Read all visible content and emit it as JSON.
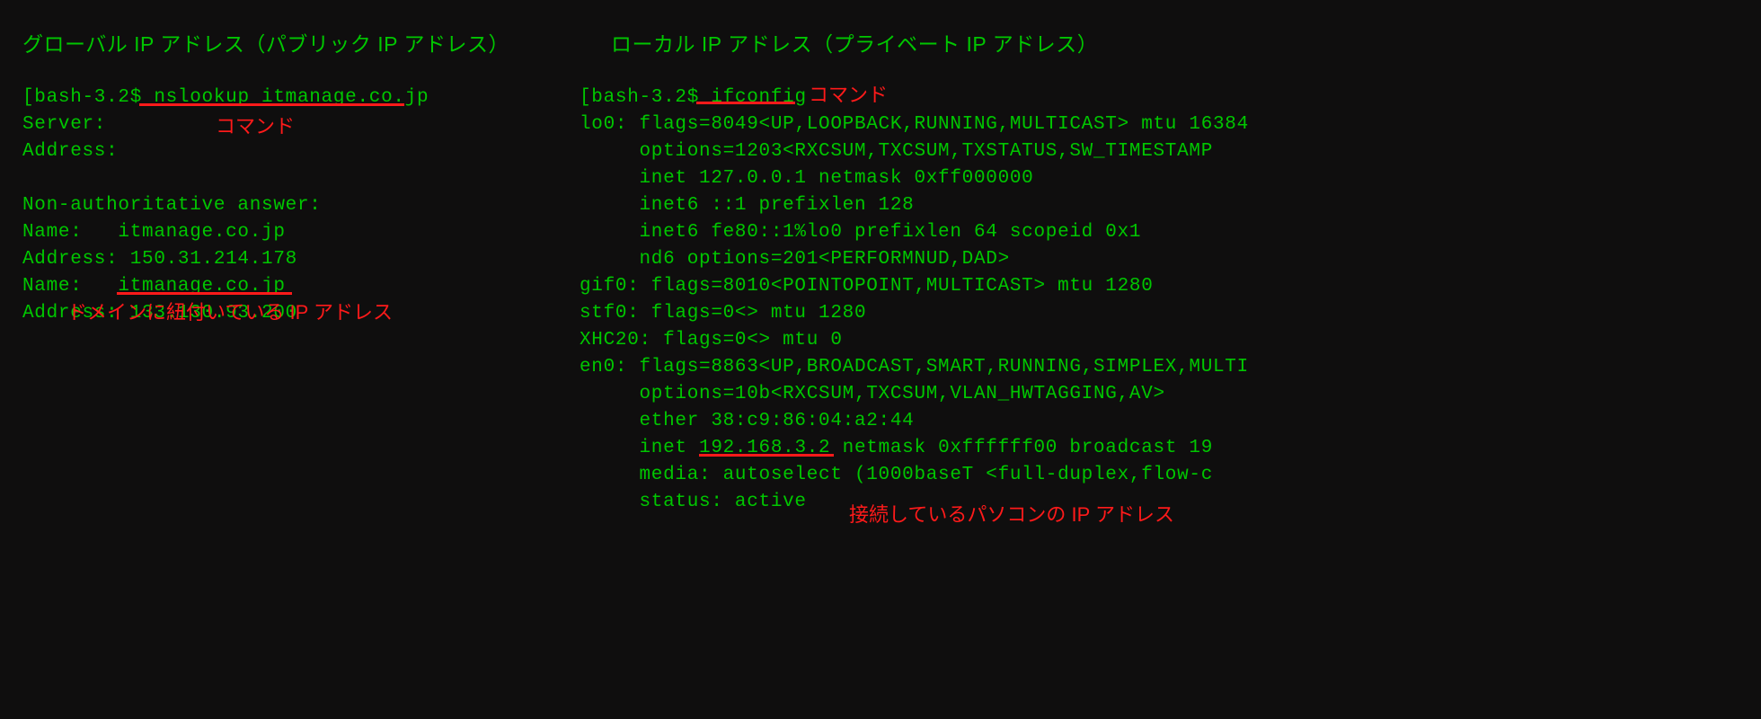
{
  "left": {
    "title": "グローバル IP アドレス（パブリック IP アドレス）",
    "prompt": "[bash-3.2$ ",
    "command": "nslookup itmanage.co.jp",
    "output": "Server:\nAddress:\n\nNon-authoritative answer:\nName:   itmanage.co.jp\nAddress: 150.31.214.178\nName:   itmanage.co.jp\nAddress: ",
    "highlight_ip": "133.130.93.200",
    "annot_command": "コマンド",
    "annot_ip": "ドメインに紐付いている IP アドレス"
  },
  "right": {
    "title": "ローカル IP アドレス（プライベート IP アドレス）",
    "prompt": "[bash-3.2$ ",
    "command": "ifconfig",
    "output_part1": "lo0: flags=8049<UP,LOOPBACK,RUNNING,MULTICAST> mtu 16384\n     options=1203<RXCSUM,TXCSUM,TXSTATUS,SW_TIMESTAMP\n     inet 127.0.0.1 netmask 0xff000000\n     inet6 ::1 prefixlen 128\n     inet6 fe80::1%lo0 prefixlen 64 scopeid 0x1\n     nd6 options=201<PERFORMNUD,DAD>\ngif0: flags=8010<POINTOPOINT,MULTICAST> mtu 1280\nstf0: flags=0<> mtu 1280\nXHC20: flags=0<> mtu 0\nen0: flags=8863<UP,BROADCAST,SMART,RUNNING,SIMPLEX,MULTI\n     options=10b<RXCSUM,TXCSUM,VLAN_HWTAGGING,AV>\n     ether 38:c9:86:04:a2:44\n     inet ",
    "highlight_ip": "192.168.3.2",
    "output_part2": " netmask 0xffffff00 broadcast 19\n     media: autoselect (1000baseT <full-duplex,flow-c\n     status: active",
    "annot_command": "コマンド",
    "annot_ip": "接続しているパソコンの IP アドレス"
  }
}
